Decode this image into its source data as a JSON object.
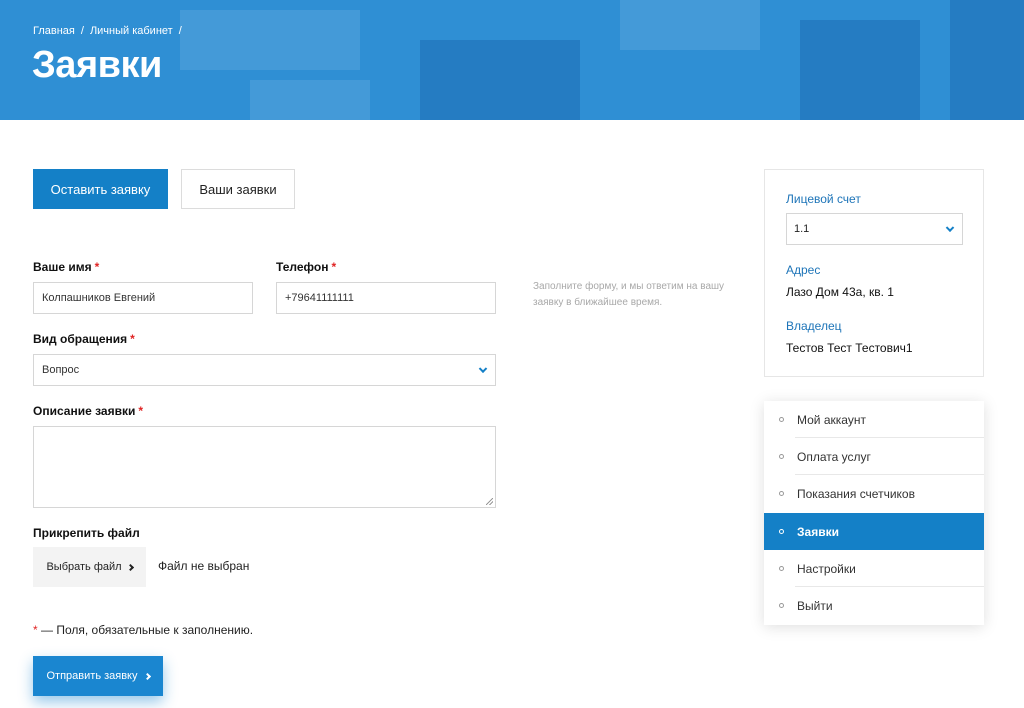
{
  "breadcrumbs": [
    "Главная",
    "Личный кабинет"
  ],
  "breadcrumb_sep": "/",
  "page_title": "Заявки",
  "tabs": {
    "new_request": "Оставить заявку",
    "my_requests": "Ваши заявки"
  },
  "form": {
    "name_label": "Ваше имя",
    "name_value": "Колпашников Евгений",
    "phone_label": "Телефон",
    "phone_value": "+79641111111",
    "type_label": "Вид обращения",
    "type_value": "Вопрос",
    "desc_label": "Описание заявки",
    "desc_value": "",
    "attach_label": "Прикрепить файл",
    "file_button": "Выбрать файл",
    "file_status": "Файл не выбран",
    "required_mark": "*",
    "required_note": "— Поля, обязательные к заполнению.",
    "submit": "Отправить заявку"
  },
  "hint": "Заполните форму, и мы ответим на вашу заявку в ближайшее время.",
  "account": {
    "account_label": "Лицевой счет",
    "account_value": "1.1",
    "address_label": "Адрес",
    "address_value": "Лазо Дом 43а, кв. 1",
    "owner_label": "Владелец",
    "owner_value": "Тестов Тест Тестович1"
  },
  "menu": [
    {
      "label": "Мой аккаунт",
      "active": false
    },
    {
      "label": "Оплата услуг",
      "active": false
    },
    {
      "label": "Показания счетчиков",
      "active": false
    },
    {
      "label": "Заявки",
      "active": true
    },
    {
      "label": "Настройки",
      "active": false
    },
    {
      "label": "Выйти",
      "active": false
    }
  ],
  "colors": {
    "accent": "#1480c7",
    "hero": "#2f8fd4",
    "required": "#e02424",
    "account_key": "#1d74b8"
  }
}
